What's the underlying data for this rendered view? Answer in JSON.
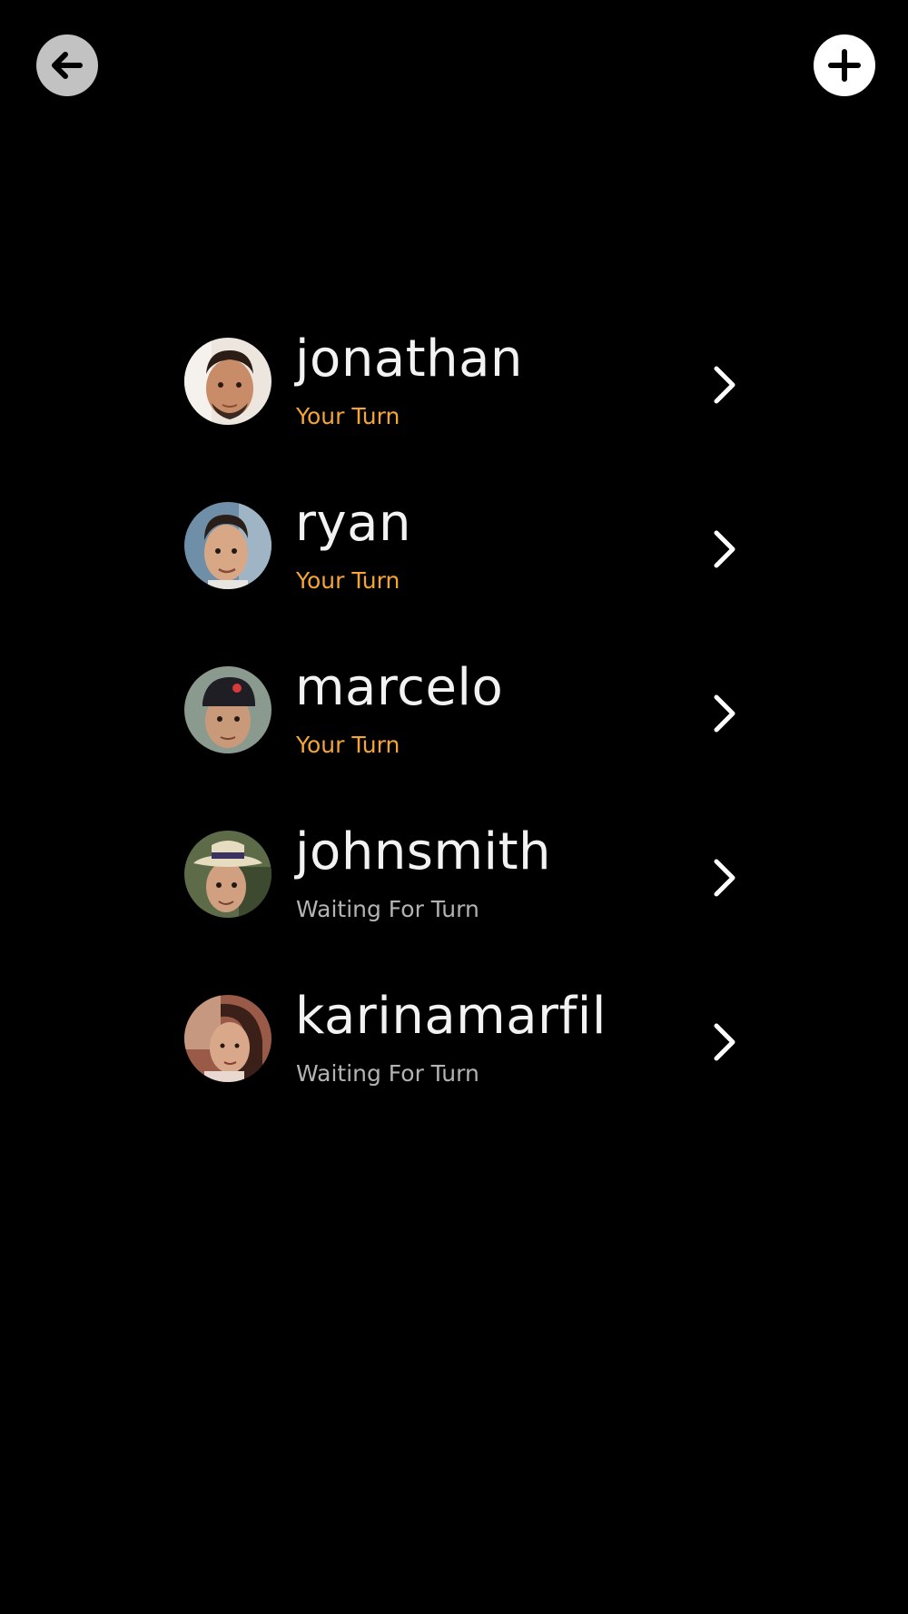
{
  "header": {
    "back_icon": "arrow-left-icon",
    "add_icon": "plus-icon"
  },
  "colors": {
    "background": "#000000",
    "your_turn": "#f4a535",
    "waiting": "#b3b3b3",
    "name": "#f2f2f2"
  },
  "players": [
    {
      "name": "jonathan",
      "status": "Your Turn",
      "state": "your-turn"
    },
    {
      "name": "ryan",
      "status": "Your Turn",
      "state": "your-turn"
    },
    {
      "name": "marcelo",
      "status": "Your Turn",
      "state": "your-turn"
    },
    {
      "name": "johnsmith",
      "status": "Waiting For Turn",
      "state": "waiting"
    },
    {
      "name": "karinamarfil",
      "status": "Waiting For Turn",
      "state": "waiting"
    }
  ]
}
